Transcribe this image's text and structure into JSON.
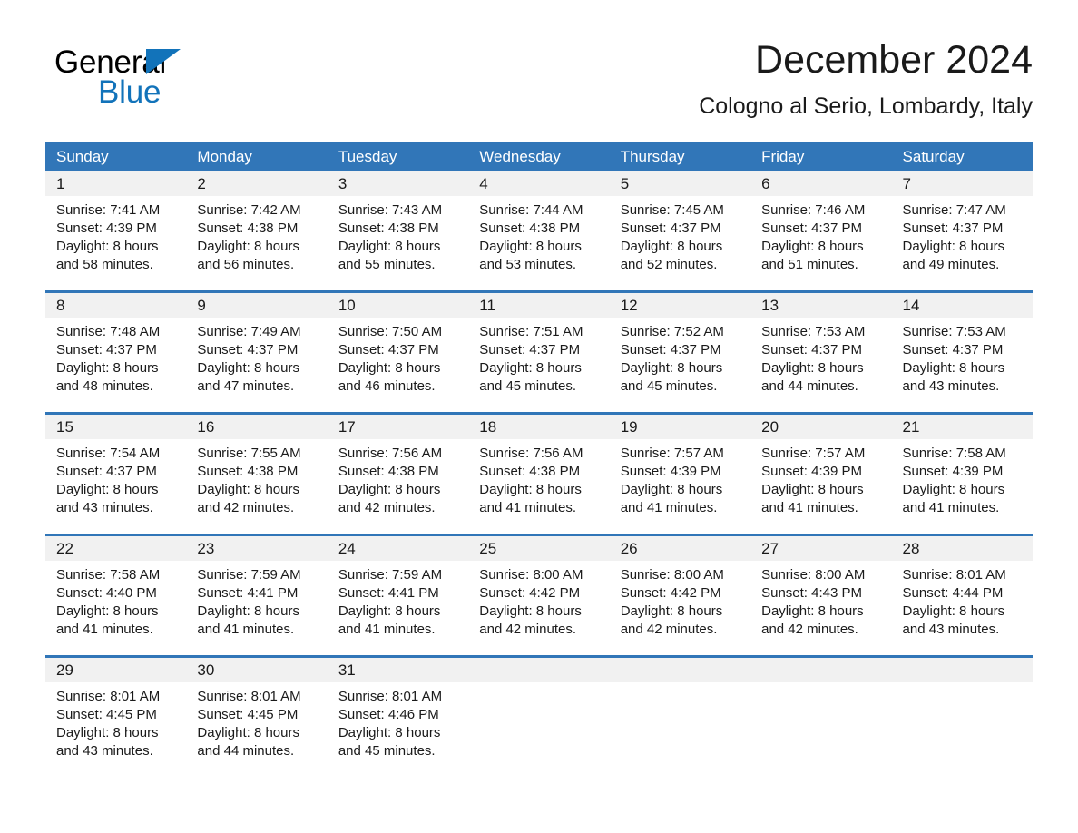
{
  "brand": {
    "line1": "General",
    "line2": "Blue",
    "triangle_color": "#1273ba",
    "icon": "triangle-icon"
  },
  "header": {
    "title": "December 2024",
    "subtitle": "Cologno al Serio, Lombardy, Italy"
  },
  "colors": {
    "header_blue": "#3176b8",
    "daynum_band": "#f1f1f1",
    "text": "#1a1a1a",
    "white": "#ffffff"
  },
  "calendar": {
    "weekdays": [
      "Sunday",
      "Monday",
      "Tuesday",
      "Wednesday",
      "Thursday",
      "Friday",
      "Saturday"
    ],
    "weeks": [
      [
        {
          "day": "1",
          "sunrise": "Sunrise: 7:41 AM",
          "sunset": "Sunset: 4:39 PM",
          "daylight1": "Daylight: 8 hours",
          "daylight2": "and 58 minutes."
        },
        {
          "day": "2",
          "sunrise": "Sunrise: 7:42 AM",
          "sunset": "Sunset: 4:38 PM",
          "daylight1": "Daylight: 8 hours",
          "daylight2": "and 56 minutes."
        },
        {
          "day": "3",
          "sunrise": "Sunrise: 7:43 AM",
          "sunset": "Sunset: 4:38 PM",
          "daylight1": "Daylight: 8 hours",
          "daylight2": "and 55 minutes."
        },
        {
          "day": "4",
          "sunrise": "Sunrise: 7:44 AM",
          "sunset": "Sunset: 4:38 PM",
          "daylight1": "Daylight: 8 hours",
          "daylight2": "and 53 minutes."
        },
        {
          "day": "5",
          "sunrise": "Sunrise: 7:45 AM",
          "sunset": "Sunset: 4:37 PM",
          "daylight1": "Daylight: 8 hours",
          "daylight2": "and 52 minutes."
        },
        {
          "day": "6",
          "sunrise": "Sunrise: 7:46 AM",
          "sunset": "Sunset: 4:37 PM",
          "daylight1": "Daylight: 8 hours",
          "daylight2": "and 51 minutes."
        },
        {
          "day": "7",
          "sunrise": "Sunrise: 7:47 AM",
          "sunset": "Sunset: 4:37 PM",
          "daylight1": "Daylight: 8 hours",
          "daylight2": "and 49 minutes."
        }
      ],
      [
        {
          "day": "8",
          "sunrise": "Sunrise: 7:48 AM",
          "sunset": "Sunset: 4:37 PM",
          "daylight1": "Daylight: 8 hours",
          "daylight2": "and 48 minutes."
        },
        {
          "day": "9",
          "sunrise": "Sunrise: 7:49 AM",
          "sunset": "Sunset: 4:37 PM",
          "daylight1": "Daylight: 8 hours",
          "daylight2": "and 47 minutes."
        },
        {
          "day": "10",
          "sunrise": "Sunrise: 7:50 AM",
          "sunset": "Sunset: 4:37 PM",
          "daylight1": "Daylight: 8 hours",
          "daylight2": "and 46 minutes."
        },
        {
          "day": "11",
          "sunrise": "Sunrise: 7:51 AM",
          "sunset": "Sunset: 4:37 PM",
          "daylight1": "Daylight: 8 hours",
          "daylight2": "and 45 minutes."
        },
        {
          "day": "12",
          "sunrise": "Sunrise: 7:52 AM",
          "sunset": "Sunset: 4:37 PM",
          "daylight1": "Daylight: 8 hours",
          "daylight2": "and 45 minutes."
        },
        {
          "day": "13",
          "sunrise": "Sunrise: 7:53 AM",
          "sunset": "Sunset: 4:37 PM",
          "daylight1": "Daylight: 8 hours",
          "daylight2": "and 44 minutes."
        },
        {
          "day": "14",
          "sunrise": "Sunrise: 7:53 AM",
          "sunset": "Sunset: 4:37 PM",
          "daylight1": "Daylight: 8 hours",
          "daylight2": "and 43 minutes."
        }
      ],
      [
        {
          "day": "15",
          "sunrise": "Sunrise: 7:54 AM",
          "sunset": "Sunset: 4:37 PM",
          "daylight1": "Daylight: 8 hours",
          "daylight2": "and 43 minutes."
        },
        {
          "day": "16",
          "sunrise": "Sunrise: 7:55 AM",
          "sunset": "Sunset: 4:38 PM",
          "daylight1": "Daylight: 8 hours",
          "daylight2": "and 42 minutes."
        },
        {
          "day": "17",
          "sunrise": "Sunrise: 7:56 AM",
          "sunset": "Sunset: 4:38 PM",
          "daylight1": "Daylight: 8 hours",
          "daylight2": "and 42 minutes."
        },
        {
          "day": "18",
          "sunrise": "Sunrise: 7:56 AM",
          "sunset": "Sunset: 4:38 PM",
          "daylight1": "Daylight: 8 hours",
          "daylight2": "and 41 minutes."
        },
        {
          "day": "19",
          "sunrise": "Sunrise: 7:57 AM",
          "sunset": "Sunset: 4:39 PM",
          "daylight1": "Daylight: 8 hours",
          "daylight2": "and 41 minutes."
        },
        {
          "day": "20",
          "sunrise": "Sunrise: 7:57 AM",
          "sunset": "Sunset: 4:39 PM",
          "daylight1": "Daylight: 8 hours",
          "daylight2": "and 41 minutes."
        },
        {
          "day": "21",
          "sunrise": "Sunrise: 7:58 AM",
          "sunset": "Sunset: 4:39 PM",
          "daylight1": "Daylight: 8 hours",
          "daylight2": "and 41 minutes."
        }
      ],
      [
        {
          "day": "22",
          "sunrise": "Sunrise: 7:58 AM",
          "sunset": "Sunset: 4:40 PM",
          "daylight1": "Daylight: 8 hours",
          "daylight2": "and 41 minutes."
        },
        {
          "day": "23",
          "sunrise": "Sunrise: 7:59 AM",
          "sunset": "Sunset: 4:41 PM",
          "daylight1": "Daylight: 8 hours",
          "daylight2": "and 41 minutes."
        },
        {
          "day": "24",
          "sunrise": "Sunrise: 7:59 AM",
          "sunset": "Sunset: 4:41 PM",
          "daylight1": "Daylight: 8 hours",
          "daylight2": "and 41 minutes."
        },
        {
          "day": "25",
          "sunrise": "Sunrise: 8:00 AM",
          "sunset": "Sunset: 4:42 PM",
          "daylight1": "Daylight: 8 hours",
          "daylight2": "and 42 minutes."
        },
        {
          "day": "26",
          "sunrise": "Sunrise: 8:00 AM",
          "sunset": "Sunset: 4:42 PM",
          "daylight1": "Daylight: 8 hours",
          "daylight2": "and 42 minutes."
        },
        {
          "day": "27",
          "sunrise": "Sunrise: 8:00 AM",
          "sunset": "Sunset: 4:43 PM",
          "daylight1": "Daylight: 8 hours",
          "daylight2": "and 42 minutes."
        },
        {
          "day": "28",
          "sunrise": "Sunrise: 8:01 AM",
          "sunset": "Sunset: 4:44 PM",
          "daylight1": "Daylight: 8 hours",
          "daylight2": "and 43 minutes."
        }
      ],
      [
        {
          "day": "29",
          "sunrise": "Sunrise: 8:01 AM",
          "sunset": "Sunset: 4:45 PM",
          "daylight1": "Daylight: 8 hours",
          "daylight2": "and 43 minutes."
        },
        {
          "day": "30",
          "sunrise": "Sunrise: 8:01 AM",
          "sunset": "Sunset: 4:45 PM",
          "daylight1": "Daylight: 8 hours",
          "daylight2": "and 44 minutes."
        },
        {
          "day": "31",
          "sunrise": "Sunrise: 8:01 AM",
          "sunset": "Sunset: 4:46 PM",
          "daylight1": "Daylight: 8 hours",
          "daylight2": "and 45 minutes."
        },
        {
          "day": "",
          "sunrise": "",
          "sunset": "",
          "daylight1": "",
          "daylight2": ""
        },
        {
          "day": "",
          "sunrise": "",
          "sunset": "",
          "daylight1": "",
          "daylight2": ""
        },
        {
          "day": "",
          "sunrise": "",
          "sunset": "",
          "daylight1": "",
          "daylight2": ""
        },
        {
          "day": "",
          "sunrise": "",
          "sunset": "",
          "daylight1": "",
          "daylight2": ""
        }
      ]
    ]
  }
}
